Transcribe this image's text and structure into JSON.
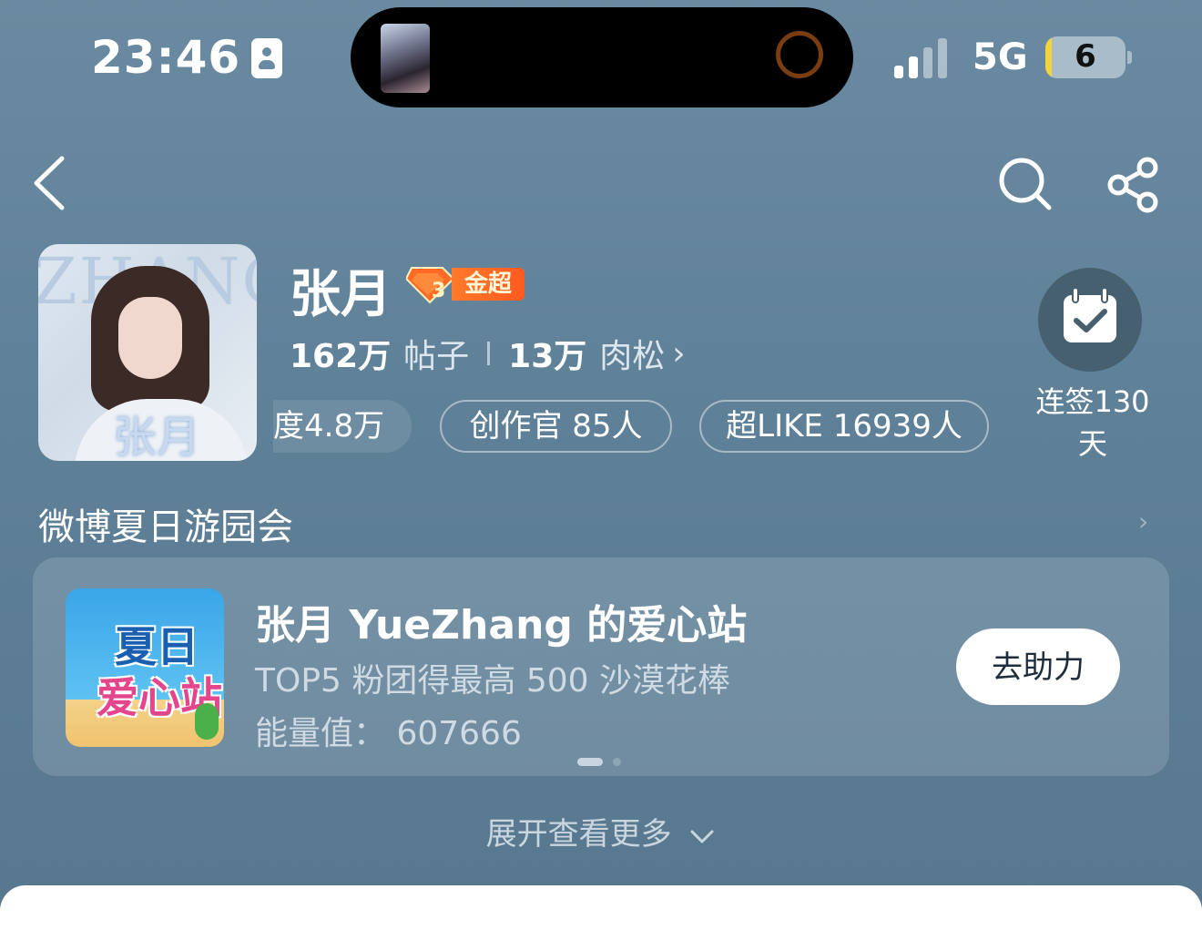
{
  "status_bar": {
    "time": "23:46",
    "network": "5G",
    "battery": "6"
  },
  "profile": {
    "name": "张月",
    "badge_label": "金超",
    "badge_level": "3",
    "avatar_watermark": "ZHANG",
    "avatar_name": "张月",
    "posts_count": "162万",
    "posts_label": "帖子",
    "fans_count": "13万",
    "fans_label": "肉松",
    "fans_chevron": "›",
    "tags": [
      {
        "label": "度4.8万"
      },
      {
        "label": "创作官 85人"
      },
      {
        "label": "超LIKE 16939人"
      }
    ],
    "checkin_label": "连签130天"
  },
  "section": {
    "title": "微博夏日游园会",
    "chevron": "›",
    "card": {
      "thumb_line1": "夏日",
      "thumb_line2": "爱心站",
      "title": "张月 YueZhang 的爱心站",
      "subtitle": "TOP5 粉团得最高 500 沙漠花棒",
      "energy": "能量值： 607666",
      "button": "去助力"
    },
    "pagination": {
      "current": 1,
      "total": 2
    }
  },
  "expand_label": "展开查看更多",
  "icons": [
    "back-icon",
    "search-icon",
    "share-icon",
    "calendar-check-icon",
    "chevron-down-icon"
  ],
  "colors": {
    "background": "#6a8aa1",
    "badge": "#ff5a1f",
    "battery_fill": "#f5d33b",
    "island_ring": "#7a3d12"
  }
}
